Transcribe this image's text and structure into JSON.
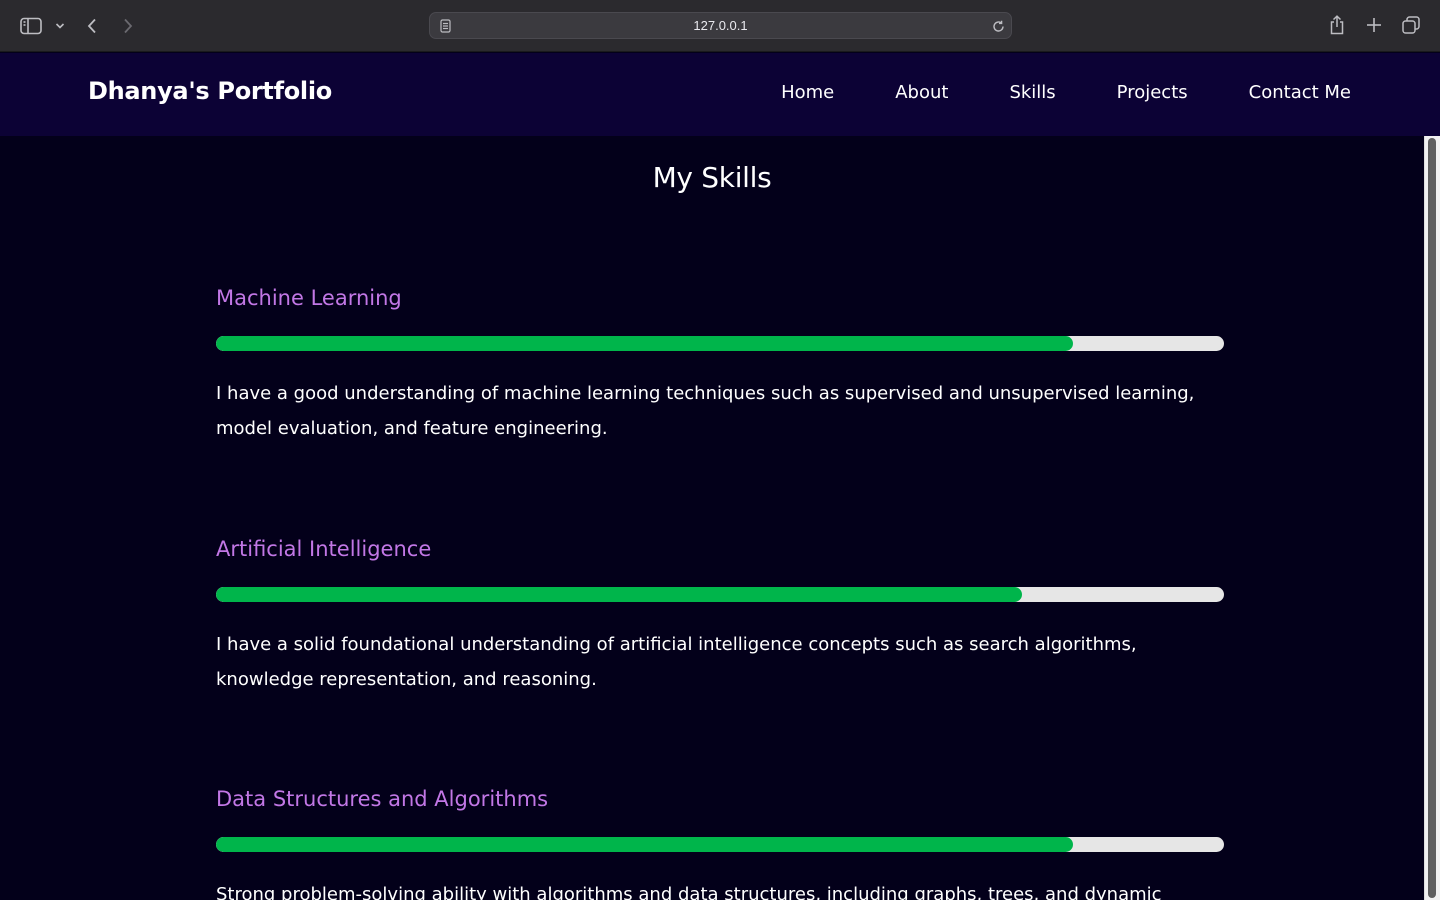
{
  "browser": {
    "url": "127.0.0.1",
    "icons": {
      "sidebar": "sidebar-icon",
      "chevron": "chevron-down-icon",
      "back": "back-arrow-icon",
      "forward": "forward-arrow-icon",
      "page": "page-icon",
      "reload": "reload-icon",
      "share": "share-icon",
      "new_tab": "plus-icon",
      "tabs": "tabs-overview-icon"
    }
  },
  "site": {
    "brand": "Dhanya's Portfolio",
    "nav": [
      "Home",
      "About",
      "Skills",
      "Projects",
      "Contact Me"
    ]
  },
  "page": {
    "title": "My Skills"
  },
  "skills": [
    {
      "name": "Machine Learning",
      "level_percent": 85,
      "description": "I have a good understanding of machine learning techniques such as supervised and unsupervised learning, model evaluation, and feature engineering."
    },
    {
      "name": "Artificial Intelligence",
      "level_percent": 80,
      "description": "I have a solid foundational understanding of artificial intelligence concepts such as search algorithms, knowledge representation, and reasoning."
    },
    {
      "name": "Data Structures and Algorithms",
      "level_percent": 85,
      "description": "Strong problem-solving ability with algorithms and data structures, including graphs, trees, and dynamic"
    }
  ],
  "colors": {
    "nav_background": "#0c0235",
    "page_background": "#03001a",
    "skill_heading": "#c277e6",
    "progress_fill": "#00b54b",
    "progress_track": "#e6e6e6"
  }
}
